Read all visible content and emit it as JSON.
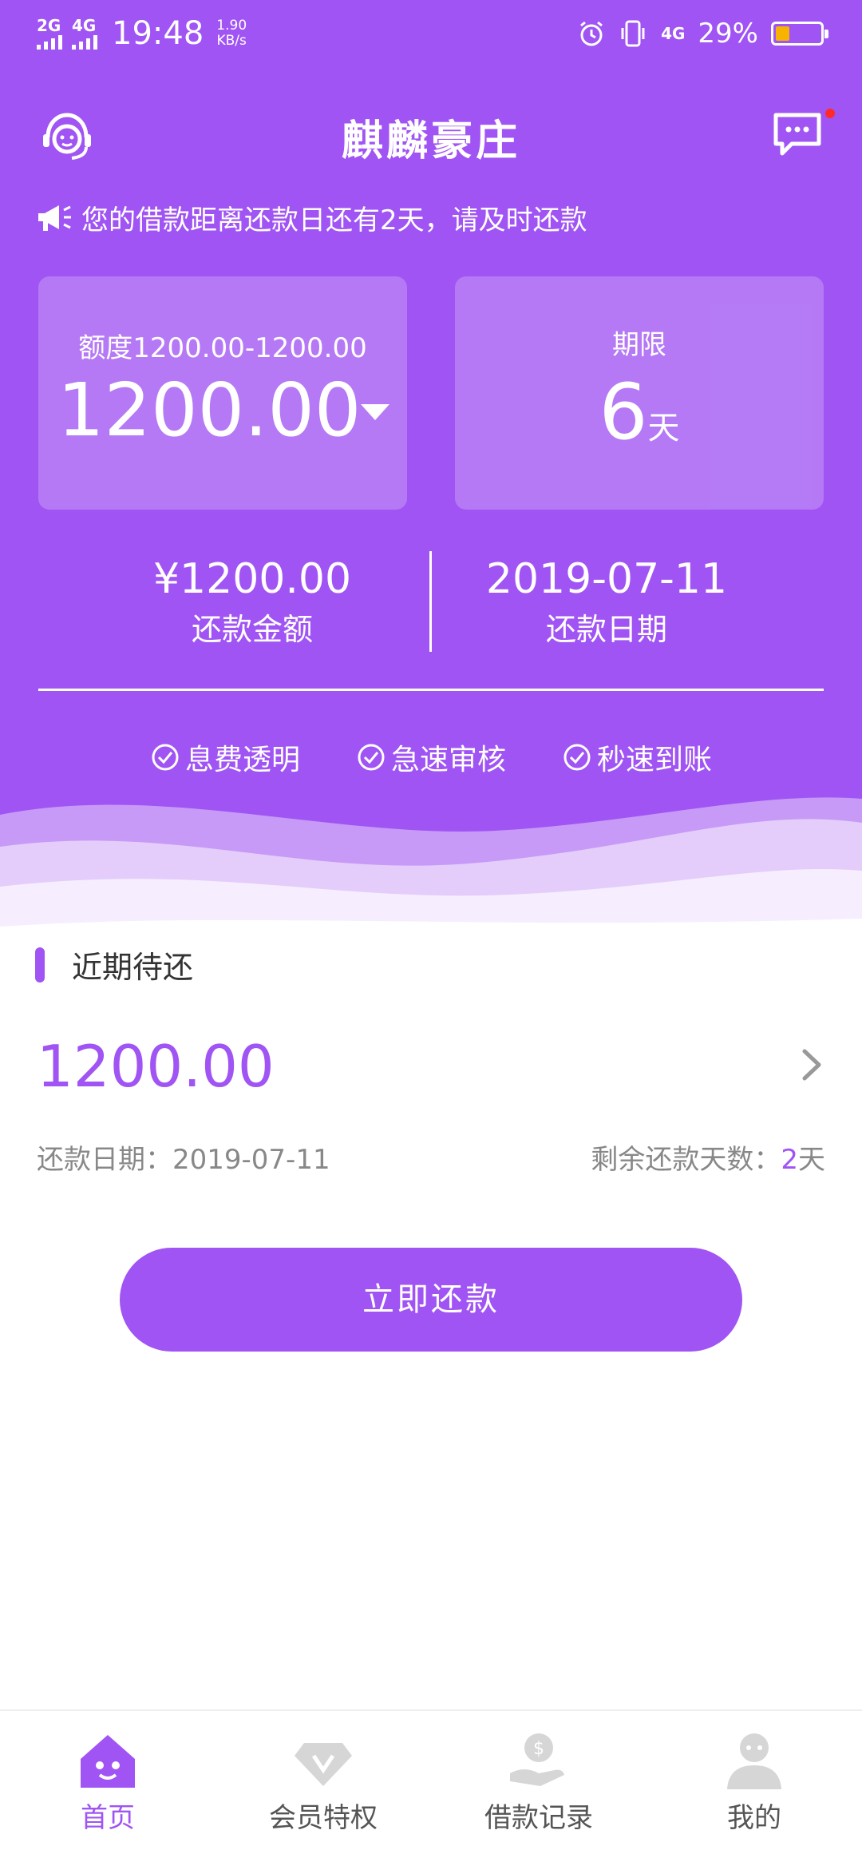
{
  "status_bar": {
    "signal1": "2G",
    "signal2": "4G",
    "time": "19:48",
    "speed_value": "1.90",
    "speed_unit": "KB/s",
    "network_right": "4G",
    "battery_percent": "29%",
    "battery_level": 0.29,
    "battery_color": "#f6b400"
  },
  "header": {
    "title": "麒麟豪庄",
    "left_icon": "headset-icon",
    "right_icon": "chat-icon"
  },
  "notice": {
    "icon": "megaphone-icon",
    "text": "您的借款距离还款日还有2天，请及时还款"
  },
  "amount_card": {
    "range_label": "额度1200.00-1200.00",
    "amount": "1200.00"
  },
  "term_card": {
    "label": "期限",
    "value": "6",
    "unit": "天"
  },
  "summary": {
    "repay_amount": "¥1200.00",
    "repay_amount_label": "还款金额",
    "repay_date": "2019-07-11",
    "repay_date_label": "还款日期"
  },
  "features": [
    "息费透明",
    "急速审核",
    "秒速到账"
  ],
  "pending": {
    "title": "近期待还",
    "amount": "1200.00",
    "date_label": "还款日期：",
    "date": "2019-07-11",
    "days_label": "剩余还款天数：",
    "days": "2",
    "days_unit": "天"
  },
  "repay_button": "立即还款",
  "tabs": [
    {
      "label": "首页",
      "icon": "home-icon",
      "active": true
    },
    {
      "label": "会员特权",
      "icon": "diamond-icon",
      "active": false
    },
    {
      "label": "借款记录",
      "icon": "loan-record-icon",
      "active": false
    },
    {
      "label": "我的",
      "icon": "user-icon",
      "active": false
    }
  ],
  "colors": {
    "brand": "#a054f3",
    "notify_dot": "#ff2a2a",
    "inactive_tab": "#cfcfcf"
  }
}
